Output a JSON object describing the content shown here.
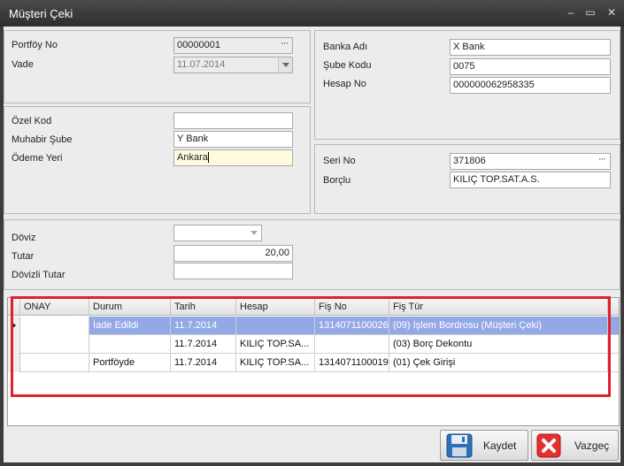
{
  "window": {
    "title": "Müşteri Çeki",
    "min": "‒",
    "max": "▭",
    "close": "✕"
  },
  "form": {
    "portfoy_no_label": "Portföy No",
    "portfoy_no": "00000001",
    "vade_label": "Vade",
    "vade": "11.07.2014",
    "ozel_kod_label": "Özel Kod",
    "ozel_kod": "",
    "muhabir_sube_label": "Muhabir Şube",
    "muhabir_sube": "Y Bank",
    "odeme_yeri_label": "Ödeme Yeri",
    "odeme_yeri": "Ankara",
    "banka_adi_label": "Banka Adı",
    "banka_adi": "X Bank",
    "sube_kodu_label": "Şube Kodu",
    "sube_kodu": "0075",
    "hesap_no_label": "Hesap No",
    "hesap_no": "000000062958335",
    "seri_no_label": "Seri No",
    "seri_no": "371806",
    "borclu_label": "Borçlu",
    "borclu": "KILIÇ TOP.SAT.A.S.",
    "doviz_label": "Döviz",
    "doviz": "",
    "tutar_label": "Tutar",
    "tutar": "20,00",
    "dovizli_tutar_label": "Dövizli Tutar",
    "dovizli_tutar": "",
    "ellipsis": "···"
  },
  "grid": {
    "headers": [
      "ONAY",
      "Durum",
      "Tarih",
      "Hesap",
      "Fiş No",
      "Fiş Tür"
    ],
    "rows": [
      {
        "onay": "",
        "durum": "İade Edildi",
        "tarih": "11.7.2014",
        "hesap": "",
        "fis_no": "1314071100026",
        "fis_tur": "(09) İşlem Bordrosu (Müşteri Çeki)"
      },
      {
        "onay": "",
        "durum": "",
        "tarih": "11.7.2014",
        "hesap": "KILIÇ TOP.SA...",
        "fis_no": "",
        "fis_tur": "(03) Borç Dekontu"
      },
      {
        "onay": "",
        "durum": "Portföyde",
        "tarih": "11.7.2014",
        "hesap": "KILIÇ TOP.SA...",
        "fis_no": "1314071100019",
        "fis_tur": "(01) Çek Girişi"
      }
    ]
  },
  "buttons": {
    "save": "Kaydet",
    "cancel": "Vazgeç"
  },
  "colors": {
    "selected_row": "#93a9e6",
    "highlight_border": "#e0202a",
    "focused_field": "#fffbdf"
  }
}
